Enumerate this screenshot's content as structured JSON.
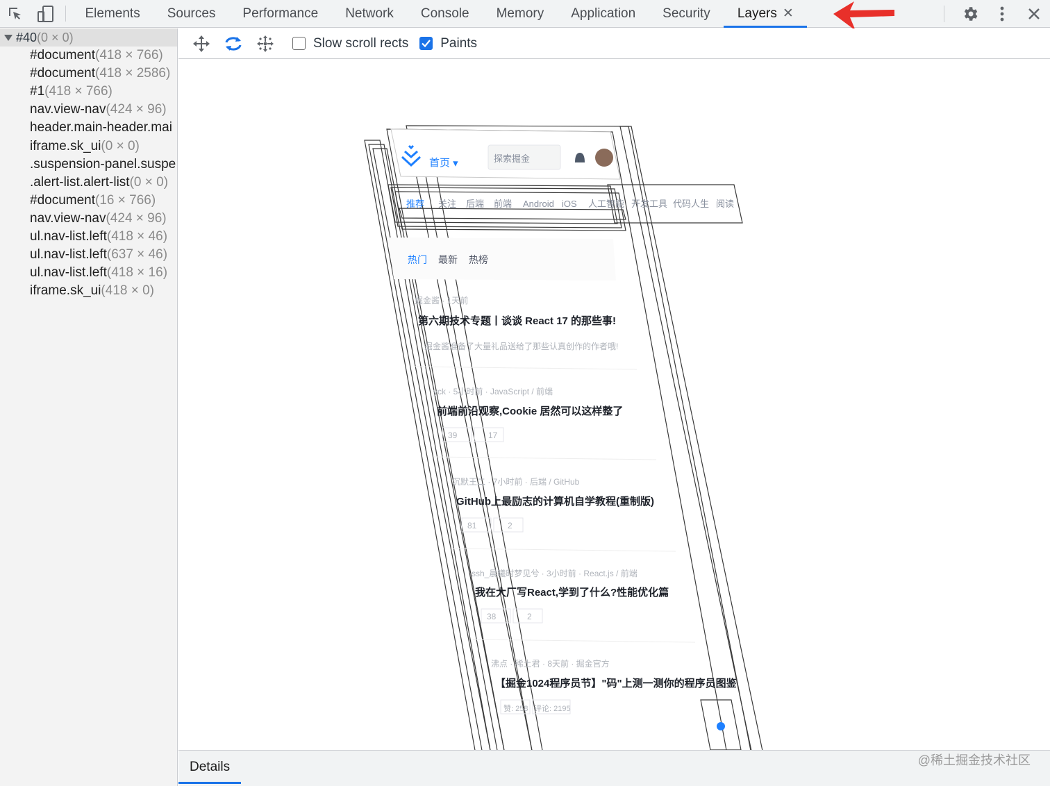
{
  "topbar": {
    "tabs": [
      {
        "label": "Elements"
      },
      {
        "label": "Sources"
      },
      {
        "label": "Performance"
      },
      {
        "label": "Network"
      },
      {
        "label": "Console"
      },
      {
        "label": "Memory"
      },
      {
        "label": "Application"
      },
      {
        "label": "Security"
      },
      {
        "label": "Layers"
      }
    ],
    "active_tab": "Layers",
    "close_glyph": "✕",
    "icons": [
      "inspect-element-icon",
      "device-toolbar-icon",
      "settings-gear-icon",
      "more-options-icon",
      "close-devtools-icon"
    ],
    "annotation_arrow_color": "#e8302a"
  },
  "sidebar": {
    "root": {
      "name": "#40",
      "size": "(0 × 0)"
    },
    "items": [
      {
        "name": "#document",
        "size": "(418 × 766)"
      },
      {
        "name": "#document",
        "size": "(418 × 2586)"
      },
      {
        "name": "#1",
        "size": "(418 × 766)"
      },
      {
        "name": "nav.view-nav",
        "size": "(424 × 96)"
      },
      {
        "name": "header.main-header.mai",
        "size": ""
      },
      {
        "name": "iframe.sk_ui",
        "size": "(0 × 0)"
      },
      {
        "name": ".suspension-panel.suspe",
        "size": ""
      },
      {
        "name": ".alert-list.alert-list",
        "size": "(0 × 0)"
      },
      {
        "name": "#document",
        "size": "(16 × 766)"
      },
      {
        "name": "nav.view-nav",
        "size": "(424 × 96)"
      },
      {
        "name": "ul.nav-list.left",
        "size": "(418 × 46)"
      },
      {
        "name": "ul.nav-list.left",
        "size": "(637 × 46)"
      },
      {
        "name": "ul.nav-list.left",
        "size": "(418 × 16)"
      },
      {
        "name": "iframe.sk_ui",
        "size": "(418 × 0)"
      }
    ]
  },
  "toolbar": {
    "tools": [
      "pan-mode-icon",
      "rotate-mode-icon",
      "reset-transform-icon"
    ],
    "slow_scroll_label": "Slow scroll rects",
    "slow_scroll_checked": false,
    "paints_label": "Paints",
    "paints_checked": true,
    "accent_color": "#1a73e8"
  },
  "viewport": {
    "header": {
      "home": "首页 ▾",
      "search": "探索掘金"
    },
    "nav": [
      "推荐",
      "关注",
      "后端",
      "前端",
      "Android",
      "iOS",
      "人工智能",
      "开发工具",
      "代码人生",
      "阅读"
    ],
    "subtabs": [
      "热门",
      "最新",
      "热榜"
    ],
    "articles": [
      {
        "meta": "掘金酱 · 1天前",
        "title": "第六期技术专题丨谈谈 React 17 的那些事!",
        "desc": "掘金酱准备了大量礼品送给了那些认真创作的作者哦!",
        "likes": "",
        "comments": ""
      },
      {
        "meta": "yck · 5小时前 · JavaScript / 前端",
        "title": "前端前沿观察,Cookie 居然可以这样整了",
        "desc": "",
        "likes": "39",
        "comments": "17"
      },
      {
        "meta": "沉默王二 · 7小时前 · 后端 / GitHub",
        "title": "GitHub上最励志的计算机自学教程(重制版)",
        "desc": "",
        "likes": "81",
        "comments": "2"
      },
      {
        "meta": "ssh_晨曦时梦见兮 · 3小时前 · React.js / 前端",
        "title": "我在大厂写React,学到了什么?性能优化篇",
        "desc": "",
        "likes": "38",
        "comments": "2"
      },
      {
        "meta": "沸点 · 稀土君 · 8天前 · 掘金官方",
        "title": "【掘金1024程序员节】\"码\"上测一测你的程序员图鉴",
        "desc": "",
        "likes": "赞: 258",
        "comments": "评论: 2195"
      }
    ],
    "brand_color": "#1e80ff"
  },
  "details": {
    "tab_label": "Details"
  },
  "watermark": "@稀土掘金技术社区"
}
